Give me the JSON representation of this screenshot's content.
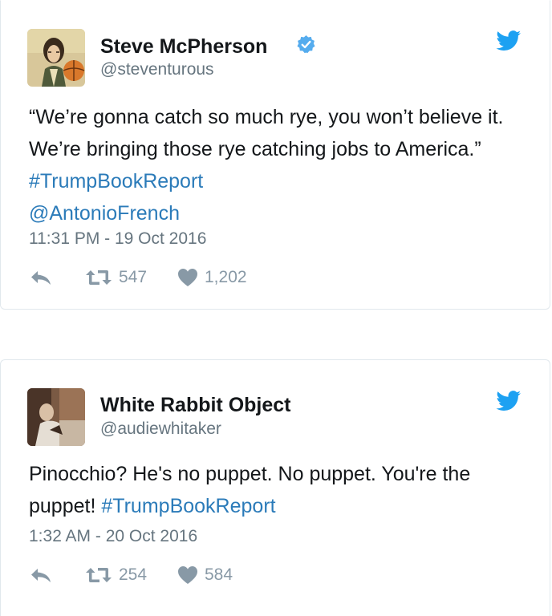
{
  "tweets": [
    {
      "author": {
        "name": "Steve McPherson",
        "handle": "@steventurous",
        "verified": true
      },
      "text_parts": {
        "p1": "“We’re gonna catch so much rye, you won’t believe it. We’re bringing those rye catching jobs to America.” ",
        "hashtag": "#TrumpBookReport",
        "mention": "@AntonioFrench"
      },
      "timestamp": "11:31 PM - 19 Oct 2016",
      "retweets": "547",
      "likes": "1,202"
    },
    {
      "author": {
        "name": "White Rabbit Object",
        "handle": "@audiewhitaker",
        "verified": false
      },
      "text_parts": {
        "p1": "Pinocchio? He's no puppet. No puppet. You're the puppet! ",
        "hashtag": "#TrumpBookReport"
      },
      "timestamp": "1:32 AM - 20 Oct 2016",
      "retweets": "254",
      "likes": "584"
    }
  ],
  "icons": {
    "verified": "verified-badge-icon",
    "bird": "twitter-bird-icon",
    "reply": "reply-arrow-icon",
    "retweet": "retweet-icon",
    "like": "heart-icon"
  },
  "colors": {
    "link": "#2b7bb9",
    "meta": "#66757f",
    "action": "#8899a6",
    "brand": "#1da1f2",
    "border": "#e1e8ed"
  }
}
